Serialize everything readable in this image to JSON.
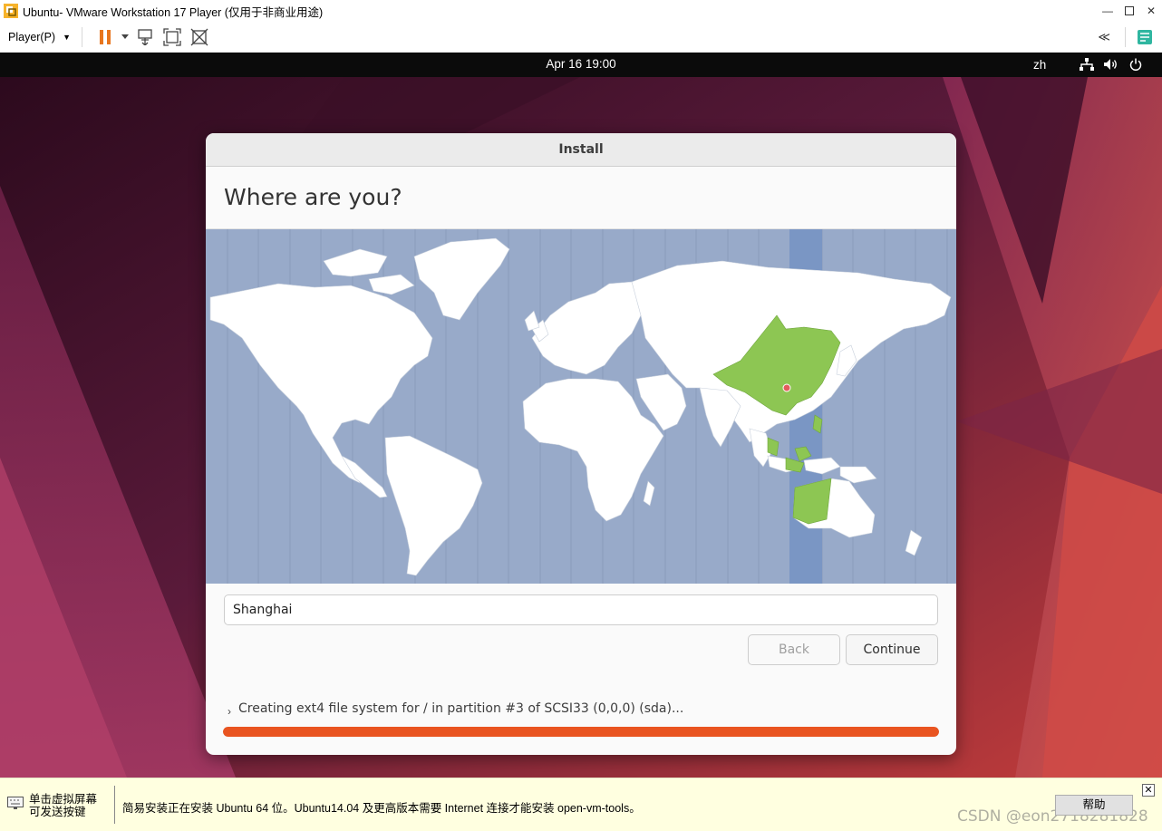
{
  "vmware": {
    "window_title": "Ubuntu- VMware Workstation 17 Player (仅用于非商业用途)",
    "player_menu": "Player(P)",
    "toolbar_icons": [
      "pause-icon",
      "dropdown-caret-icon",
      "send-ctrl-alt-del-icon",
      "fit-guest-icon",
      "unity-icon"
    ],
    "collapse_label": "≪",
    "bottom_bar": {
      "hint_line1": "单击虚拟屏幕",
      "hint_line2": "可发送按键",
      "message": "简易安装正在安装 Ubuntu 64 位。Ubuntu14.04 及更高版本需要 Internet 连接才能安装 open-vm-tools。",
      "help_button": "帮助",
      "watermark": "CSDN @eon2718281828"
    }
  },
  "ubuntu_topbar": {
    "clock": "Apr 16  19:00",
    "language": "zh"
  },
  "installer": {
    "window_title": "Install",
    "heading": "Where are you?",
    "timezone_value": "Shanghai",
    "back_button": "Back",
    "continue_button": "Continue",
    "progress_text": "Creating ext4 file system for / in partition #3 of SCSI33 (0,0,0) (sda)...",
    "progress": 1.0,
    "colors": {
      "accent": "#e95420",
      "selected_region": "#8dc653",
      "ocean": "#98aac9",
      "selected_band": "#7a96c4"
    }
  }
}
